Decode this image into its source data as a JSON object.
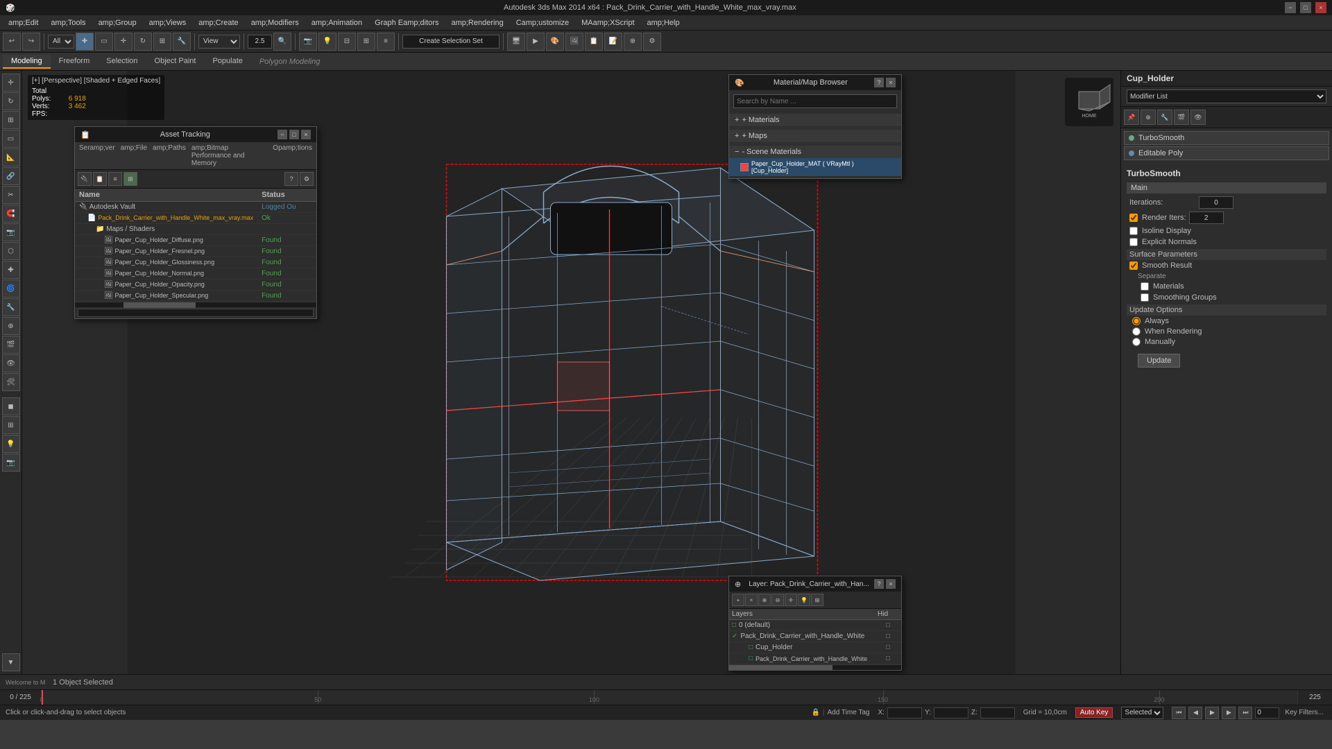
{
  "titlebar": {
    "title": "Autodesk 3ds Max 2014 x64   :   Pack_Drink_Carrier_with_Handle_White_max_vray.max",
    "min_btn": "−",
    "max_btn": "□",
    "close_btn": "×"
  },
  "menubar": {
    "items": [
      {
        "id": "edit",
        "label": "amp;Edit"
      },
      {
        "id": "tools",
        "label": "amp;Tools"
      },
      {
        "id": "group",
        "label": "amp;Group"
      },
      {
        "id": "views",
        "label": "amp;Views"
      },
      {
        "id": "create",
        "label": "amp;Create"
      },
      {
        "id": "modifiers",
        "label": "amp;Modifiers"
      },
      {
        "id": "animation",
        "label": "amp;Animation"
      },
      {
        "id": "graph-editors",
        "label": "Graph Eamp;ditors"
      },
      {
        "id": "rendering",
        "label": "amp;Rendering"
      },
      {
        "id": "customize",
        "label": "Camp;ustomize"
      },
      {
        "id": "maxscript",
        "label": "MAamp;XScript"
      },
      {
        "id": "help",
        "label": "amp;Help"
      }
    ]
  },
  "toolbar": {
    "undo_label": "↩",
    "redo_label": "↪",
    "select_mode": "All",
    "zoom_factor": "2.5",
    "view_label": "View",
    "create_selection": "Create Selection Set"
  },
  "subtoolbar": {
    "tabs": [
      {
        "id": "modeling",
        "label": "Modeling",
        "active": true
      },
      {
        "id": "freeform",
        "label": "Freeform"
      },
      {
        "id": "selection",
        "label": "Selection"
      },
      {
        "id": "object-paint",
        "label": "Object Paint"
      },
      {
        "id": "populate",
        "label": "Populate"
      }
    ],
    "label": "Polygon Modeling"
  },
  "viewport": {
    "label": "[+] [Perspective] [Shaded + Edged Faces]",
    "stats_total_label": "Total",
    "stats_polys_label": "Polys:",
    "stats_polys_value": "6 918",
    "stats_verts_label": "Verts:",
    "stats_verts_value": "3 462",
    "stats_fps_label": "FPS:"
  },
  "right_panel": {
    "object_name": "Cup_Holder",
    "modifier_list_label": "Modifier List",
    "modifiers": [
      {
        "name": "TurboSmooth",
        "color": "#6a8"
      },
      {
        "name": "Editable Poly",
        "color": "#68a"
      }
    ],
    "turbosmooth": {
      "title": "TurboSmooth",
      "main_label": "Main",
      "iterations_label": "Iterations:",
      "iterations_value": "0",
      "render_iters_label": "Render Iters:",
      "render_iters_value": "2",
      "isoline_display_label": "Isoline Display",
      "explicit_normals_label": "Explicit Normals",
      "surface_params_label": "Surface Parameters",
      "smooth_result_label": "Smooth Result",
      "separate_label": "Separate",
      "materials_label": "Materials",
      "smoothing_groups_label": "Smoothing Groups",
      "update_options_label": "Update Options",
      "always_label": "Always",
      "when_rendering_label": "When Rendering",
      "manually_label": "Manually",
      "update_btn_label": "Update"
    }
  },
  "asset_panel": {
    "title": "Asset Tracking",
    "menu_items": [
      {
        "id": "seramp-ver",
        "label": "Seramp;ver"
      },
      {
        "id": "amp-file",
        "label": "amp;File"
      },
      {
        "id": "amp-paths",
        "label": "amp;Paths"
      },
      {
        "id": "amp-bitmap",
        "label": "amp;Bitmap Performance and Memory"
      },
      {
        "id": "opamp-tions",
        "label": "Opamp;tions"
      }
    ],
    "columns": [
      {
        "id": "name",
        "label": "Name"
      },
      {
        "id": "status",
        "label": "Status"
      }
    ],
    "rows": [
      {
        "type": "vault",
        "name": "Autodesk Vault",
        "status": "Logged Ou",
        "indent": 0
      },
      {
        "type": "file",
        "name": "Pack_Drink_Carrier_with_Handle_White_max_vray.max",
        "status": "Ok",
        "indent": 1
      },
      {
        "type": "folder",
        "name": "Maps / Shaders",
        "status": "",
        "indent": 2
      },
      {
        "type": "map",
        "name": "Paper_Cup_Holder_Diffuse.png",
        "status": "Found",
        "indent": 3
      },
      {
        "type": "map",
        "name": "Paper_Cup_Holder_Fresnel.png",
        "status": "Found",
        "indent": 3
      },
      {
        "type": "map",
        "name": "Paper_Cup_Holder_Glossiness.png",
        "status": "Found",
        "indent": 3
      },
      {
        "type": "map",
        "name": "Paper_Cup_Holder_Normal.png",
        "status": "Found",
        "indent": 3
      },
      {
        "type": "map",
        "name": "Paper_Cup_Holder_Opacity.png",
        "status": "Found",
        "indent": 3
      },
      {
        "type": "map",
        "name": "Paper_Cup_Holder_Specular.png",
        "status": "Found",
        "indent": 3
      }
    ]
  },
  "material_panel": {
    "title": "Material/Map Browser",
    "search_placeholder": "Search by Name ...",
    "sections": [
      {
        "id": "materials",
        "label": "+ Materials",
        "expanded": false
      },
      {
        "id": "maps",
        "label": "+ Maps",
        "expanded": false
      },
      {
        "id": "scene-materials",
        "label": "- Scene Materials",
        "expanded": true
      }
    ],
    "scene_materials": [
      {
        "name": "Paper_Cup_Holder_MAT ( VRayMtl ) [Cup_Holder]",
        "active": true,
        "color": "#e44"
      }
    ]
  },
  "layer_panel": {
    "title": "Layer: Pack_Drink_Carrier_with_Han...",
    "columns": [
      {
        "id": "layers",
        "label": "Layers"
      },
      {
        "id": "hid",
        "label": "Hid"
      }
    ],
    "layers": [
      {
        "name": "0 (default)",
        "indent": 0,
        "checked": false
      },
      {
        "name": "Pack_Drink_Carrier_with_Handle_White",
        "indent": 0,
        "checked": true
      },
      {
        "name": "Cup_Holder",
        "indent": 1,
        "checked": false
      },
      {
        "name": "Pack_Drink_Carrier_with_Handle_White",
        "indent": 1,
        "checked": false
      }
    ]
  },
  "status_bar": {
    "object_count": "1 Object Selected",
    "help_text": "Click or click-and-drag to select objects",
    "x_label": "X:",
    "y_label": "Y:",
    "z_label": "Z:",
    "grid_label": "Grid = 10,0cm",
    "auto_key_label": "Auto Key",
    "selected_label": "Selected",
    "welcome_text": "Welcome to M"
  },
  "timeline": {
    "current_frame": "0",
    "total_frames": "225",
    "frame_label": "0 / 225"
  },
  "playback": {
    "prev_key_btn": "⏮",
    "prev_frame_btn": "◀",
    "play_btn": "▶",
    "next_frame_btn": "▶",
    "next_key_btn": "⏭",
    "key_filters_label": "Key Filters..."
  },
  "icons": {
    "search": "🔍",
    "gear": "⚙",
    "close": "×",
    "minimize": "−",
    "maximize": "□",
    "folder": "📁",
    "file": "📄",
    "image": "🖼",
    "check": "✓",
    "plus": "+",
    "minus": "−",
    "arrow_right": "▶",
    "arrow_down": "▼",
    "lock": "🔒",
    "key": "🔑",
    "light": "💡",
    "camera": "📷"
  }
}
